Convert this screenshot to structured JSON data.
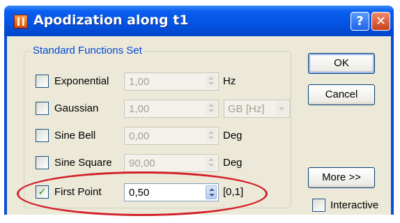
{
  "window": {
    "title": "Apodization along t1",
    "help_label": "?",
    "close_label": "✕",
    "icon": "app-logo-icon"
  },
  "group": {
    "label": "Standard Functions Set"
  },
  "rows": [
    {
      "label": "Exponential",
      "value": "1,00",
      "unit": "Hz",
      "checked": false,
      "enabled": false
    },
    {
      "label": "Gaussian",
      "value": "1,00",
      "combo": "GB [Hz]",
      "checked": false,
      "enabled": false
    },
    {
      "label": "Sine Bell",
      "value": "0,00",
      "unit": "Deg",
      "checked": false,
      "enabled": false
    },
    {
      "label": "Sine Square",
      "value": "90,00",
      "unit": "Deg",
      "checked": false,
      "enabled": false
    },
    {
      "label": "First Point",
      "value": "0,50",
      "unit": "[0,1]",
      "checked": true,
      "enabled": true,
      "check_mark": "✓"
    }
  ],
  "buttons": {
    "ok": "OK",
    "cancel": "Cancel",
    "more": "More >>"
  },
  "interactive": {
    "label": "Interactive",
    "checked": false
  },
  "colors": {
    "title_bar": "#0454e6",
    "dialog_face": "#ece9d8",
    "group_label": "#0046d5",
    "highlight_ring": "#d4202a"
  }
}
